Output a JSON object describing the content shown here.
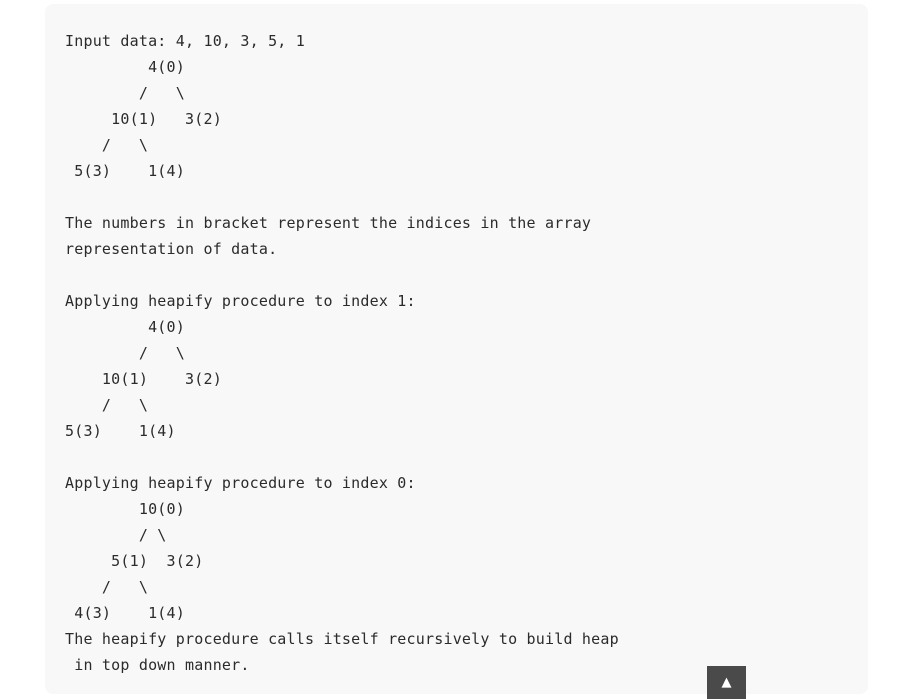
{
  "code_block": {
    "lines": [
      "Input data: 4, 10, 3, 5, 1",
      "         4(0)",
      "        /   \\",
      "     10(1)   3(2)",
      "    /   \\",
      " 5(3)    1(4)",
      "",
      "The numbers in bracket represent the indices in the array ",
      "representation of data.",
      "",
      "Applying heapify procedure to index 1:",
      "         4(0)",
      "        /   \\",
      "    10(1)    3(2)",
      "    /   \\",
      "5(3)    1(4)",
      "",
      "Applying heapify procedure to index 0:",
      "        10(0)",
      "        / \\",
      "     5(1)  3(2)",
      "    /   \\",
      " 4(3)    1(4)",
      "The heapify procedure calls itself recursively to build heap",
      " in top down manner."
    ]
  },
  "scroll_top_button": {
    "icon": "▲"
  }
}
